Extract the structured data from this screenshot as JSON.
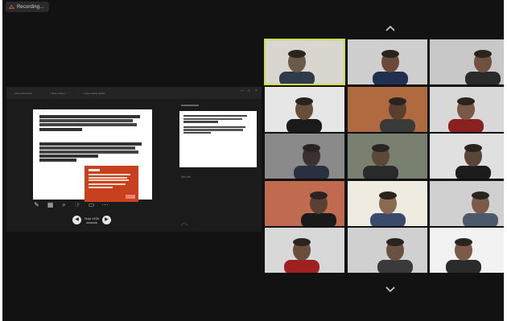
{
  "recording": {
    "label": "Recording..."
  },
  "share": {
    "tabs": [
      "",
      "",
      ""
    ],
    "slide_counter": "",
    "slide_total": "",
    "slide_paragraphs": [
      "",
      ""
    ],
    "popup": {
      "title": "",
      "text": "",
      "button": ""
    },
    "nav": {
      "label": "Slayt 14/36",
      "time": ""
    },
    "next_slide_title": "",
    "next_slide_paragraphs": [
      "",
      ""
    ],
    "notes_label": "Not Yok"
  },
  "grid": {
    "active_tile": 0,
    "tile_count": 20
  },
  "icons": [
    "chevron-up-icon",
    "chevron-down-icon",
    "pen-icon",
    "grid-icon",
    "zoom-icon",
    "pointer-icon",
    "screen-icon",
    "more-icon"
  ],
  "colors": {
    "active_speaker": "#cde04a",
    "popup": "#c8411f",
    "background": "#121212"
  }
}
